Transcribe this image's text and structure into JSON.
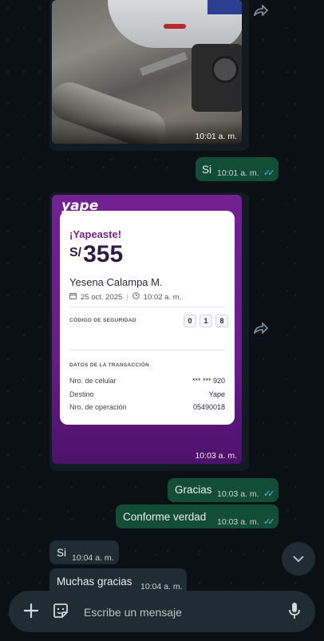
{
  "messages": {
    "photo_time": "10:01 a. m.",
    "si_out_text": "Si",
    "si_out_time": "10:01 a. m.",
    "receipt_time": "10:03 a. m.",
    "gracias_text": "Gracias",
    "gracias_time": "10:03 a. m.",
    "conforme_text": "Conforme verdad",
    "conforme_time": "10:03 a. m.",
    "si_in_text": "Si",
    "si_in_time": "10:04 a. m.",
    "muchas_text": "Muchas gracias",
    "muchas_time": "10:04 a. m.",
    "read_ticks": "✓✓"
  },
  "receipt": {
    "logo": "yape",
    "header": "¡Yapeaste!",
    "currency": "S/",
    "amount": "355",
    "name": "Yesena Calampa M.",
    "date": "25 oct. 2025",
    "time": "10:02 a. m.",
    "security_label": "CÓDIGO DE SEGURIDAD",
    "security_code": [
      "0",
      "1",
      "8"
    ],
    "details_label": "DATOS DE LA TRANSACCIÓN",
    "rows": [
      {
        "label": "Nro. de celular",
        "value": "*** *** 920"
      },
      {
        "label": "Destino",
        "value": "Yape"
      },
      {
        "label": "Nro. de operación",
        "value": "05490018"
      }
    ]
  },
  "composer": {
    "placeholder": "Escribe un mensaje"
  },
  "colors": {
    "incoming": "#202c33",
    "outgoing": "#144d37",
    "read_tick": "#53bdeb",
    "yape_purple": "#722092"
  },
  "icons": {
    "forward": "forward-icon",
    "scroll_down": "chevron-down-icon",
    "attach": "plus-icon",
    "sticker": "sticker-icon",
    "mic": "mic-icon"
  }
}
